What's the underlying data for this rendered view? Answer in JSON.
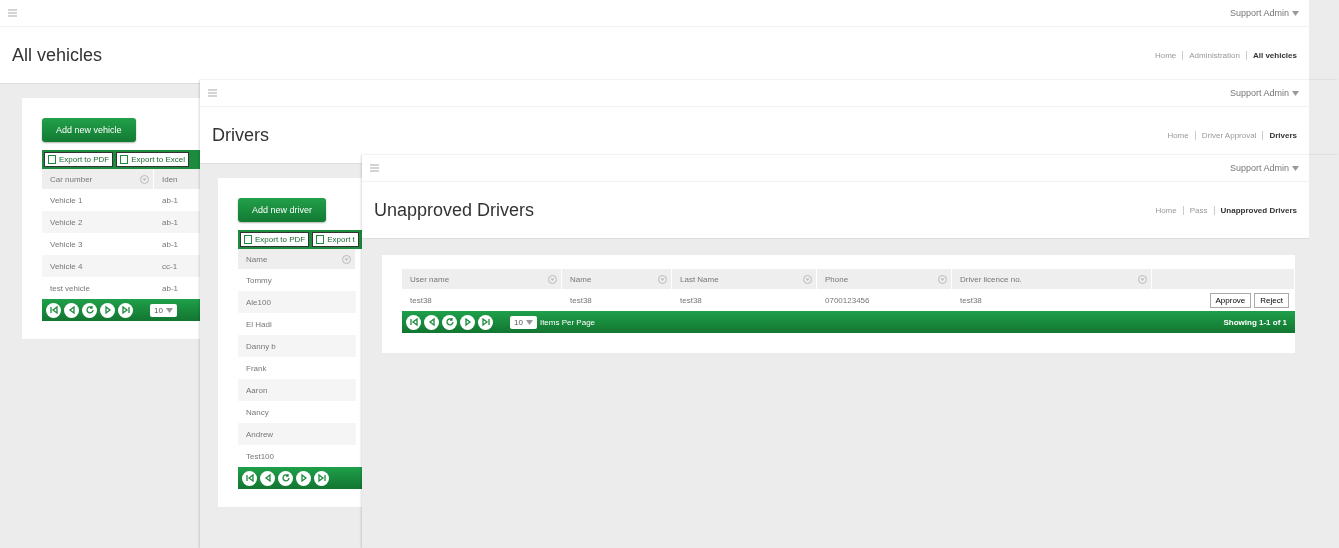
{
  "windows": [
    {
      "user_menu": "Support Admin",
      "title": "All vehicles",
      "breadcrumbs": [
        {
          "label": "Home",
          "selected": false
        },
        {
          "label": "Administration",
          "selected": false
        },
        {
          "label": "All vehicles",
          "selected": true
        }
      ],
      "card": {
        "add_button": "Add new vehicle",
        "export_buttons": [
          "Export to PDF",
          "Export to Excel"
        ],
        "columns": [
          "Car number",
          "Iden"
        ],
        "rows": [
          {
            "cells": [
              "Vehicle 1",
              "ab-1"
            ]
          },
          {
            "cells": [
              "Vehicle 2",
              "ab-1"
            ]
          },
          {
            "cells": [
              "Vehicle 3",
              "ab-1"
            ]
          },
          {
            "cells": [
              "Vehicle 4",
              "cc-1"
            ]
          },
          {
            "cells": [
              "test vehicle",
              "ab-1"
            ]
          }
        ],
        "pager": {
          "page_size": "10"
        }
      }
    },
    {
      "user_menu": "Support Admin",
      "title": "Drivers",
      "breadcrumbs": [
        {
          "label": "Home",
          "selected": false
        },
        {
          "label": "Driver Approval",
          "selected": false
        },
        {
          "label": "Drivers",
          "selected": true
        }
      ],
      "card": {
        "add_button": "Add new driver",
        "export_buttons": [
          "Export to PDF",
          "Export t"
        ],
        "columns": [
          "Name"
        ],
        "rows": [
          {
            "cells": [
              "Tommy"
            ]
          },
          {
            "cells": [
              "Ale100"
            ]
          },
          {
            "cells": [
              "El Hadi"
            ]
          },
          {
            "cells": [
              "Danny b"
            ]
          },
          {
            "cells": [
              "Frank"
            ]
          },
          {
            "cells": [
              "Aaron"
            ]
          },
          {
            "cells": [
              "Nancy"
            ]
          },
          {
            "cells": [
              "Andrew"
            ]
          },
          {
            "cells": [
              "Test100"
            ]
          }
        ],
        "pager_bar": true
      }
    },
    {
      "user_menu": "Support Admin",
      "title": "Unapproved Drivers",
      "breadcrumbs": [
        {
          "label": "Home",
          "selected": false
        },
        {
          "label": "Pass",
          "selected": false
        },
        {
          "label": "Unapproved Drivers",
          "selected": true
        }
      ],
      "card": {
        "columns": [
          "User name",
          "Name",
          "Last Name",
          "Phone",
          "Driver licence no."
        ],
        "rows": [
          {
            "cells": [
              "test38",
              "test38",
              "test38",
              "0700123456",
              "test38"
            ],
            "actions": [
              "Approve",
              "Reject"
            ]
          }
        ],
        "pager": {
          "page_size": "10",
          "items_per_page": "Items Per Page",
          "summary": "Showing 1-1 of 1"
        }
      }
    }
  ]
}
